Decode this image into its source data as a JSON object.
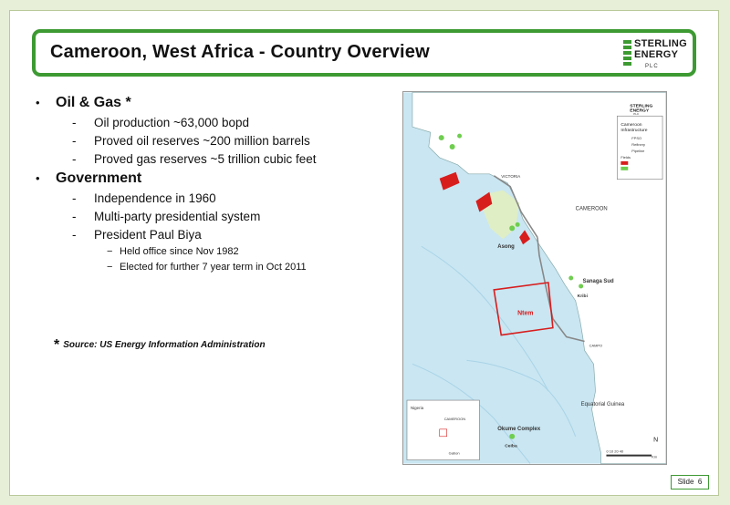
{
  "title": "Cameroon, West Africa - Country Overview",
  "logo": {
    "line1": "STERLING",
    "line2": "ENERGY",
    "line3": "PLC"
  },
  "sections": [
    {
      "heading": "Oil & Gas *",
      "items": [
        "Oil production ~63,000 bopd",
        "Proved oil reserves ~200 million barrels",
        "Proved gas reserves ~5 trillion cubic feet"
      ]
    },
    {
      "heading": "Government",
      "items": [
        "Independence in 1960",
        "Multi-party presidential system",
        "President Paul Biya"
      ],
      "subitems": [
        "Held office since Nov 1982",
        "Elected for further 7 year term in Oct 2011"
      ]
    }
  ],
  "source": "Source: US Energy Information Administration",
  "source_star": "*",
  "map": {
    "logo_line1": "STERLING",
    "logo_line2": "ENERGY",
    "logo_line3": "PLC",
    "legend_title_1": "Cameroon",
    "legend_title_2": "Infrastructure",
    "legend_items": [
      "FPSO",
      "Refinery",
      "Pipeline",
      "Fields"
    ],
    "labels": {
      "victoria": "VICTORIA",
      "cameroon": "CAMEROON",
      "asong": "Asong",
      "sanaga_sud": "Sanaga Sud",
      "kribi": "Kribi",
      "ntem": "Ntem",
      "campo": "CAMPO",
      "equatorial_guinea": "Equatorial Guinea",
      "okume": "Okume Complex",
      "ceiba": "Ceiba",
      "inset_nigeria": "Nigeria",
      "inset_cameroon": "CAMEROON",
      "inset_gabon": "Gabon",
      "north": "N",
      "scale": "0  10  20     40",
      "km": "Km"
    }
  },
  "slide_number_label": "Slide",
  "slide_number": "6",
  "colors": {
    "accent": "#3d9a32",
    "field": "#d81d1d",
    "sea": "#c9e6f2",
    "land": "#ffffff"
  }
}
